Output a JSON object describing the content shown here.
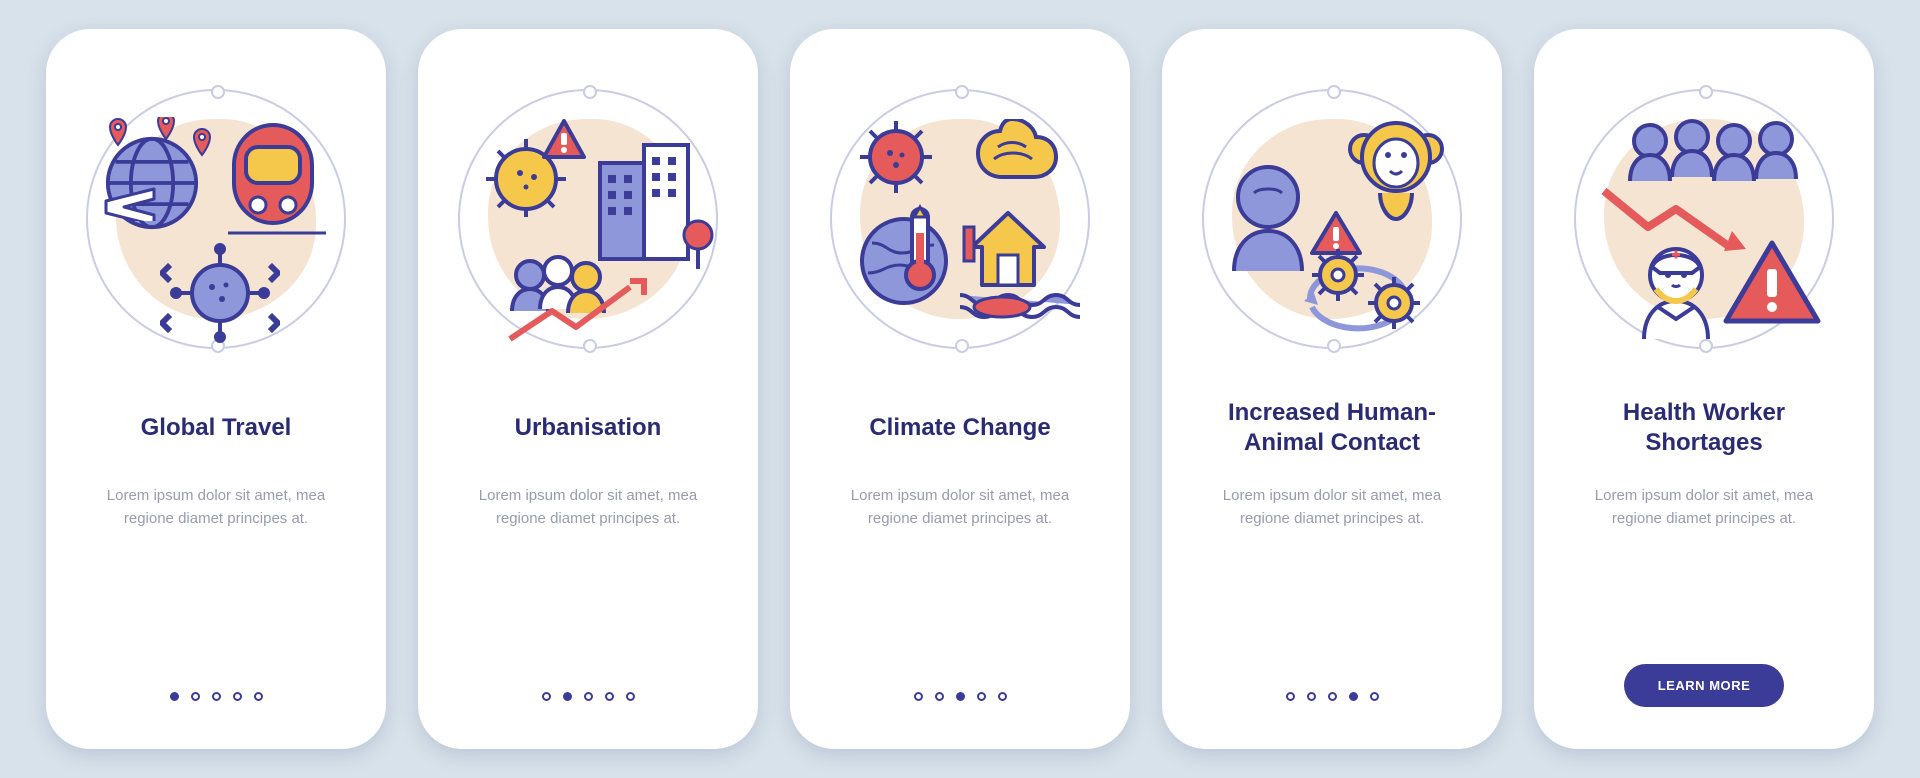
{
  "slides": [
    {
      "title": "Global Travel",
      "body": "Lorem ipsum dolor sit amet, mea regione diamet principes at.",
      "activeDot": 0,
      "cta": null,
      "icon": "global-travel-icon"
    },
    {
      "title": "Urbanisation",
      "body": "Lorem ipsum dolor sit amet, mea regione diamet principes at.",
      "activeDot": 1,
      "cta": null,
      "icon": "urbanisation-icon"
    },
    {
      "title": "Climate Change",
      "body": "Lorem ipsum dolor sit amet, mea regione diamet principes at.",
      "activeDot": 2,
      "cta": null,
      "icon": "climate-change-icon"
    },
    {
      "title": "Increased Human-Animal Contact",
      "body": "Lorem ipsum dolor sit amet, mea regione diamet principes at.",
      "activeDot": 3,
      "cta": null,
      "icon": "human-animal-icon"
    },
    {
      "title": "Health Worker Shortages",
      "body": "Lorem ipsum dolor sit amet, mea regione diamet principes at.",
      "activeDot": 4,
      "cta": "LEARN MORE",
      "icon": "worker-shortage-icon"
    }
  ],
  "dotCount": 5,
  "colors": {
    "primary": "#3B3B98",
    "accent": "#E55B5B",
    "yellow": "#F5C84C",
    "blue": "#8E97D9",
    "peach": "#F6E4D3"
  }
}
